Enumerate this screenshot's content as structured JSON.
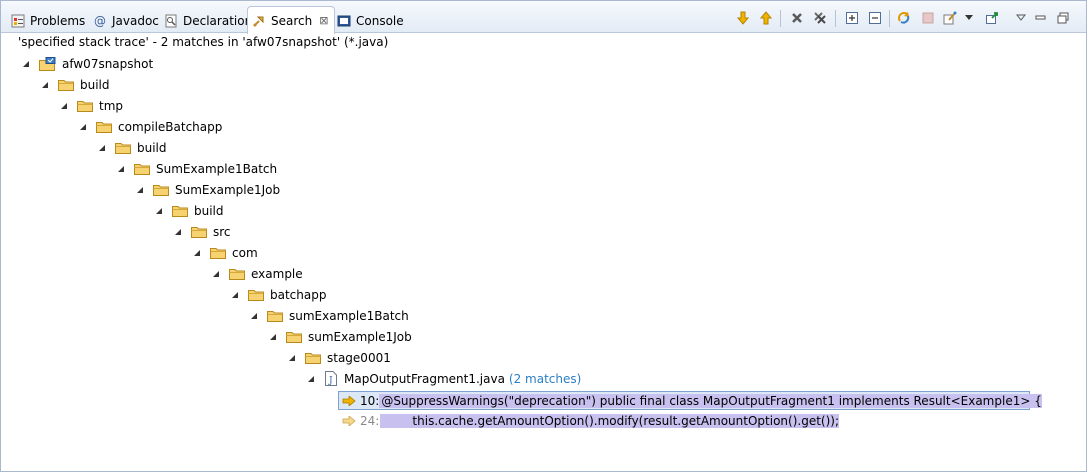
{
  "tabs": [
    {
      "label": "Problems",
      "icon": "problems-icon"
    },
    {
      "label": "Javadoc",
      "icon": "javadoc-icon"
    },
    {
      "label": "Declaration",
      "icon": "declaration-icon"
    },
    {
      "label": "Search",
      "icon": "search-icon",
      "active": true
    },
    {
      "label": "Console",
      "icon": "console-icon"
    }
  ],
  "toolbar": [
    "next-match-icon",
    "previous-match-icon",
    "remove-selected-matches-icon",
    "remove-all-matches-icon",
    "expand-all-icon",
    "collapse-all-icon",
    "run-search-again-icon",
    "cancel-search-icon",
    "show-previous-searches-icon",
    "pin-view-icon",
    "view-menu-icon",
    "minimize-icon",
    "maximize-icon"
  ],
  "summary": "'specified stack trace' - 2 matches in 'afw07snapshot' (*.java)",
  "tree": [
    {
      "label": "afw07snapshot",
      "type": "project"
    },
    {
      "label": "build",
      "type": "folder"
    },
    {
      "label": "tmp",
      "type": "folder"
    },
    {
      "label": "compileBatchapp",
      "type": "folder"
    },
    {
      "label": "build",
      "type": "folder"
    },
    {
      "label": "SumExample1Batch",
      "type": "folder"
    },
    {
      "label": "SumExample1Job",
      "type": "folder"
    },
    {
      "label": "build",
      "type": "folder"
    },
    {
      "label": "src",
      "type": "folder"
    },
    {
      "label": "com",
      "type": "folder"
    },
    {
      "label": "example",
      "type": "folder"
    },
    {
      "label": "batchapp",
      "type": "folder"
    },
    {
      "label": "sumExample1Batch",
      "type": "folder"
    },
    {
      "label": "sumExample1Job",
      "type": "folder"
    },
    {
      "label": "stage0001",
      "type": "folder"
    },
    {
      "label": "MapOutputFragment1.java",
      "type": "file",
      "matches": "(2 matches)"
    }
  ],
  "results": [
    {
      "line": "10:",
      "code": "@SuppressWarnings(\"deprecation\") public final class MapOutputFragment1 implements Result<Example1> {"
    },
    {
      "line": "24:",
      "code": "        this.cache.getAmountOption().modify(result.getAmountOption().get());"
    }
  ],
  "colors": {
    "accent": "#2a7fc6",
    "selection": "#dce8f6",
    "match_highlight": "#c8c1ef",
    "folder": "#e8b83a"
  }
}
